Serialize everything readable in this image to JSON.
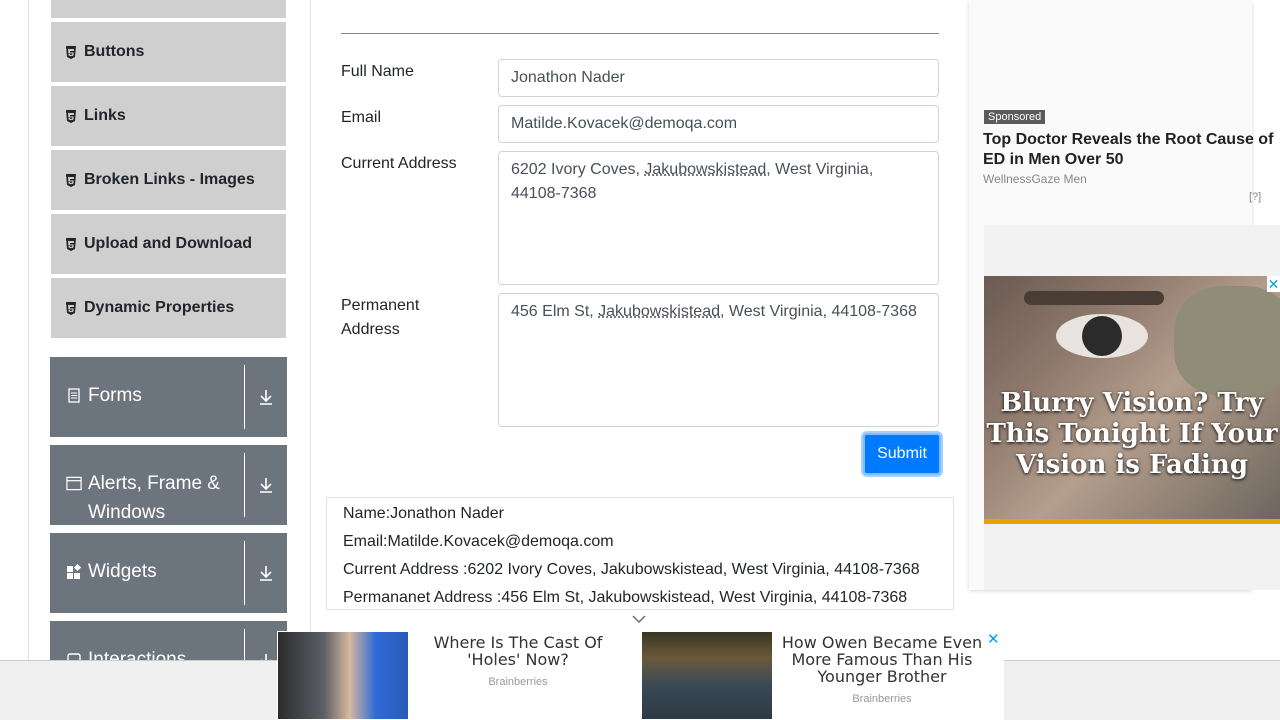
{
  "sidebar": {
    "elements_items": [
      {
        "label": "Buttons"
      },
      {
        "label": "Links"
      },
      {
        "label": "Broken Links - Images"
      },
      {
        "label": "Upload and Download"
      },
      {
        "label": "Dynamic Properties"
      }
    ],
    "groups": [
      {
        "label": "Forms",
        "icon": "document-icon"
      },
      {
        "label": "Alerts, Frame & Windows",
        "icon": "window-icon"
      },
      {
        "label": "Widgets",
        "icon": "widgets-icon"
      },
      {
        "label": "Interactions",
        "icon": "interactions-icon"
      }
    ]
  },
  "form": {
    "full_name_label": "Full Name",
    "full_name_value": "Jonathon Nader",
    "email_label": "Email",
    "email_value": "Matilde.Kovacek@demoqa.com",
    "current_address_label": "Current Address",
    "current_address_value_pre": "6202 Ivory Coves, ",
    "current_address_value_u": "Jakubowskistead",
    "current_address_value_post": ", West Virginia, 44108-7368",
    "permanent_address_label_1": "Permanent",
    "permanent_address_label_2": "Address",
    "permanent_address_value_pre": "456 Elm St, ",
    "permanent_address_value_u": "Jakubowskistead",
    "permanent_address_value_post": ", West Virginia, 44108-7368",
    "submit_label": "Submit"
  },
  "output": {
    "name": "Name:Jonathon Nader",
    "email": "Email:Matilde.Kovacek@demoqa.com",
    "current_address": "Current Address :6202 Ivory Coves, Jakubowskistead, West Virginia, 44108-7368",
    "permanent_address": "Permananet Address :456 Elm St, Jakubowskistead, West Virginia, 44108-7368"
  },
  "right_ad": {
    "sponsored": "Sponsored",
    "title": "Top Doctor Reveals the Root Cause of ED in Men Over 50",
    "source": "WellnessGaze Men",
    "info": "[?]",
    "image_text": "Blurry Vision? Try This Tonight If Your Vision is Fading",
    "close": "✕"
  },
  "bottom_ad": {
    "cards": [
      {
        "title": "Where Is The Cast Of 'Holes' Now?",
        "source": "Brainberries"
      },
      {
        "title": "How Owen Became Even More Famous Than His Younger Brother",
        "source": "Brainberries"
      }
    ],
    "close": "✕"
  },
  "colors": {
    "group_bg": "#6c757d",
    "sub_item_bg": "#cfcfcf",
    "submit_bg": "#007bff",
    "ad_accent": "#e5a400"
  }
}
